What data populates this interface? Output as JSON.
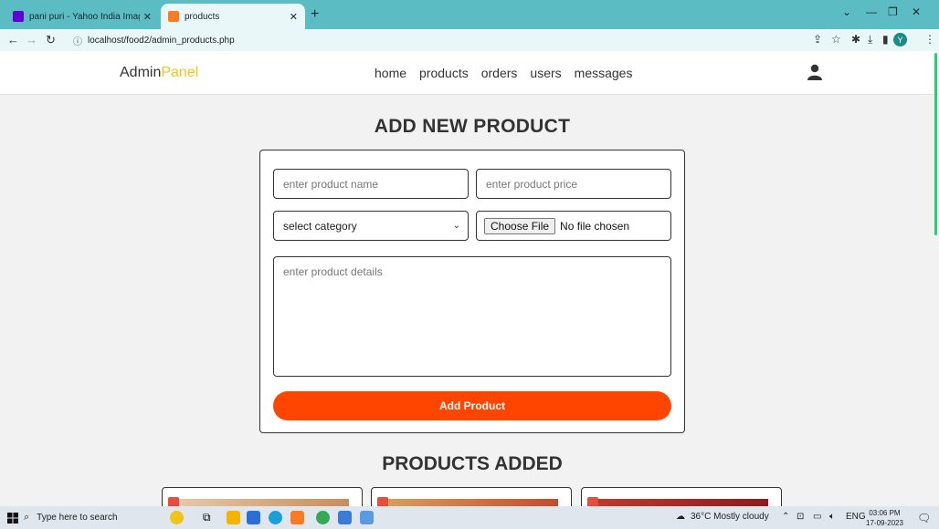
{
  "browser": {
    "tabs": [
      {
        "label": "pani puri - Yahoo India Image Se",
        "icon": "yahoo-favicon"
      },
      {
        "label": "products",
        "icon": "xampp-favicon"
      }
    ],
    "new_tab": "+",
    "url": "localhost/food2/admin_products.php"
  },
  "header": {
    "logo_main": "Admin",
    "logo_accent": "Panel",
    "nav": [
      "home",
      "products",
      "orders",
      "users",
      "messages"
    ]
  },
  "form": {
    "title": "ADD NEW PRODUCT",
    "name_placeholder": "enter product name",
    "price_placeholder": "enter product price",
    "category_selected": "select category",
    "file_button": "Choose File",
    "file_status": "No file chosen",
    "details_placeholder": "enter product details",
    "submit_label": "Add Product"
  },
  "products": {
    "title": "PRODUCTS ADDED"
  },
  "taskbar": {
    "search_placeholder": "Type here to search",
    "weather": "36°C Mostly cloudy",
    "language": "ENG",
    "time": "03:06 PM",
    "date": "17-09-2023"
  },
  "colors": {
    "accent": "#ff4500",
    "logo_accent": "#f5c518",
    "tab_bar": "#5cbcc4"
  }
}
